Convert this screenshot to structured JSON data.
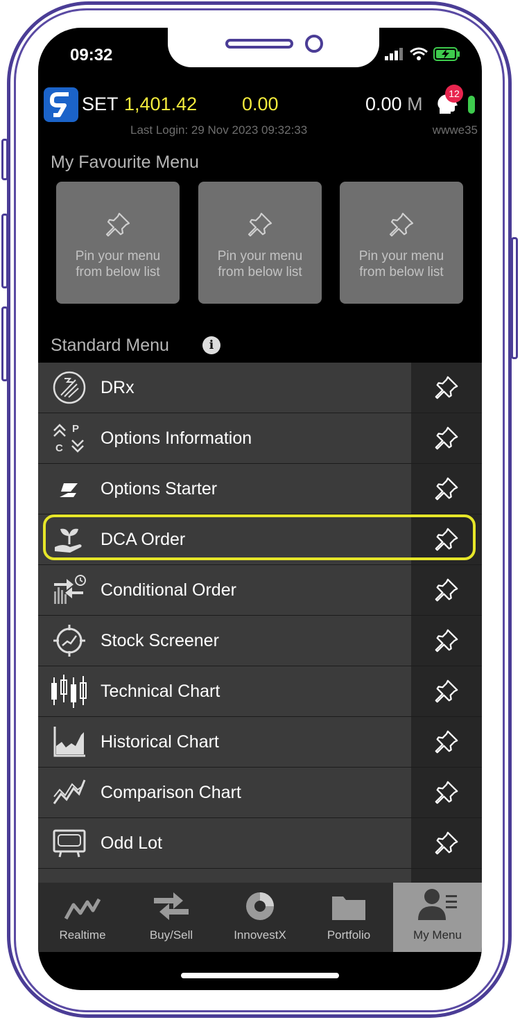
{
  "status": {
    "time": "09:32"
  },
  "header": {
    "index_name": "SET",
    "index_value": "1,401.42",
    "index_change": "0.00",
    "volume_value": "0.00",
    "volume_unit": "M",
    "notification_count": "12",
    "last_login": "Last Login: 29 Nov 2023 09:32:33",
    "username": "wwwe35"
  },
  "favourites": {
    "title": "My Favourite Menu",
    "cards": [
      {
        "label": "Pin your menu\nfrom below list"
      },
      {
        "label": "Pin your menu\nfrom below list"
      },
      {
        "label": "Pin your menu\nfrom below list"
      }
    ]
  },
  "standard_menu": {
    "title": "Standard Menu",
    "items": [
      {
        "label": "DRx",
        "icon": "drx-icon"
      },
      {
        "label": "Options Information",
        "icon": "options-information-icon"
      },
      {
        "label": "Options Starter",
        "icon": "options-starter-icon"
      },
      {
        "label": "DCA Order",
        "icon": "dca-order-icon"
      },
      {
        "label": "Conditional Order",
        "icon": "conditional-order-icon"
      },
      {
        "label": "Stock Screener",
        "icon": "stock-screener-icon"
      },
      {
        "label": "Technical Chart",
        "icon": "technical-chart-icon"
      },
      {
        "label": "Historical Chart",
        "icon": "historical-chart-icon"
      },
      {
        "label": "Comparison Chart",
        "icon": "comparison-chart-icon"
      },
      {
        "label": "Odd Lot",
        "icon": "odd-lot-icon"
      }
    ]
  },
  "tabbar": {
    "tabs": [
      {
        "label": "Realtime"
      },
      {
        "label": "Buy/Sell"
      },
      {
        "label": "InnovestX"
      },
      {
        "label": "Portfolio"
      },
      {
        "label": "My Menu"
      }
    ],
    "active": "My Menu"
  },
  "colors": {
    "frame": "#4b3d96",
    "highlight": "#e6e629",
    "index_yellow": "#f2ea3c",
    "badge": "#e8254e",
    "status_green": "#3ecb4d"
  }
}
